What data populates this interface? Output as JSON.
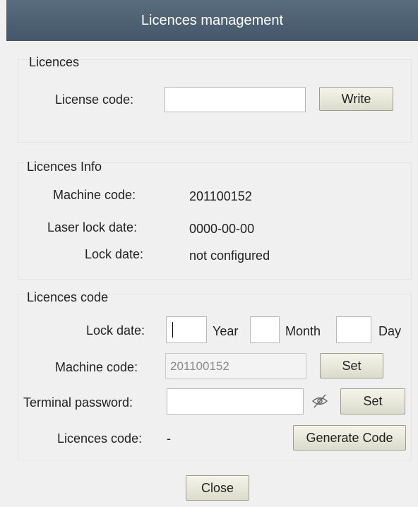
{
  "window": {
    "title": "Licences management"
  },
  "licences": {
    "group_title": "Licences",
    "license_code_label": "License code:",
    "license_code_value": "",
    "write_button": "Write"
  },
  "info": {
    "group_title": "Licences Info",
    "machine_code_label": "Machine code:",
    "machine_code_value": "201100152",
    "laser_lock_date_label": "Laser lock date:",
    "laser_lock_date_value": "0000-00-00",
    "lock_date_label": "Lock date:",
    "lock_date_value": "not configured"
  },
  "code": {
    "group_title": "Licences code",
    "lock_date_label": "Lock date:",
    "year_value": "",
    "year_label": "Year",
    "month_value": "",
    "month_label": "Month",
    "day_value": "",
    "day_label": "Day",
    "machine_code_label": "Machine code:",
    "machine_code_value": "201100152",
    "machine_set_button": "Set",
    "terminal_password_label": "Terminal password:",
    "terminal_password_value": "",
    "password_visibility_icon": "eye-hidden-icon",
    "terminal_set_button": "Set",
    "licences_code_label": "Licences code:",
    "licences_code_value": "-",
    "generate_button": "Generate Code"
  },
  "footer": {
    "close_button": "Close"
  }
}
